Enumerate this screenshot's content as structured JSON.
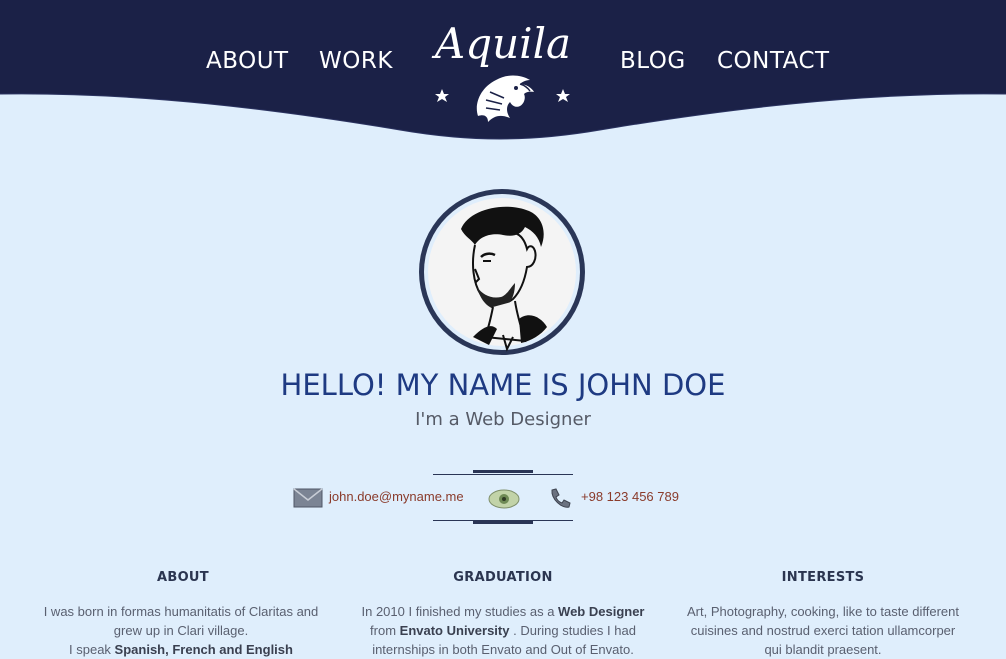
{
  "nav": {
    "about": "ABOUT",
    "work": "WORK",
    "blog": "BLOG",
    "contact": "CONTACT"
  },
  "logo": {
    "text": "Aquila",
    "icon": "eagle-icon"
  },
  "profile": {
    "headline": "HELLO! MY NAME IS JOHN DOE",
    "subtitle": "I'm a Web Designer"
  },
  "contact": {
    "email": "john.doe@myname.me",
    "phone": "+98 123 456 789",
    "icons": [
      "mail-icon",
      "eye-icon",
      "phone-icon"
    ]
  },
  "columns": {
    "about": {
      "title": "ABOUT",
      "line1": "I was born in formas humanitatis of Claritas and",
      "line2": "grew up in Clari village.",
      "line3_pre": "I speak ",
      "line3_bold": "Spanish, French and English"
    },
    "graduation": {
      "title": "GRADUATION",
      "line1_pre": "In 2010 I finished my studies as a ",
      "line1_bold": "Web Designer",
      "line2_pre": "from ",
      "line2_bold": "Envato University",
      "line2_post": " . During studies I had",
      "line3": "internships in both Envato and Out of Envato."
    },
    "interests": {
      "title": "INTERESTS",
      "line1": "Art, Photography, cooking, like to taste different",
      "line2": "cuisines and nostrud exerci tation ullamcorper",
      "line3": "qui blandit praesent."
    }
  },
  "colors": {
    "header": "#1b2147",
    "background": "#dfeefc",
    "headline": "#1e3a82",
    "link": "#8a3b2b"
  }
}
